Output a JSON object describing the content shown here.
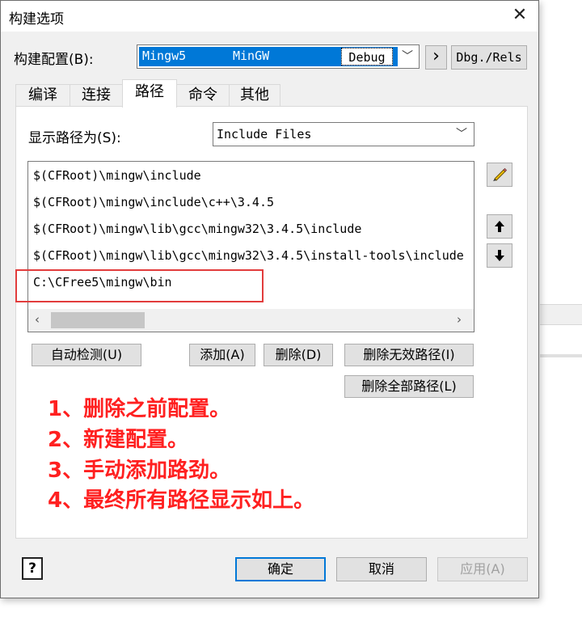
{
  "window": {
    "title": "构建选项",
    "close_glyph": "✕"
  },
  "config": {
    "label": "构建配置(B):",
    "name": "Mingw5",
    "compiler": "MinGW",
    "mode": "Debug",
    "arrow_btn": "›",
    "dbg_rels_btn": "Dbg./Rels"
  },
  "tabs": [
    {
      "label": "编译"
    },
    {
      "label": "连接"
    },
    {
      "label": "路径"
    },
    {
      "label": "命令"
    },
    {
      "label": "其他"
    }
  ],
  "path_view": {
    "label": "显示路径为(S):",
    "selected": "Include Files"
  },
  "paths": [
    "$(CFRoot)\\mingw\\include",
    "$(CFRoot)\\mingw\\include\\c++\\3.4.5",
    "$(CFRoot)\\mingw\\lib\\gcc\\mingw32\\3.4.5\\include",
    "$(CFRoot)\\mingw\\lib\\gcc\\mingw32\\3.4.5\\install-tools\\include",
    "C:\\CFree5\\mingw\\bin"
  ],
  "actions": {
    "auto_detect": "自动检测(U)",
    "add": "添加(A)",
    "delete": "删除(D)",
    "delete_invalid": "删除无效路径(I)",
    "delete_all": "删除全部路径(L)"
  },
  "notes": [
    "1、删除之前配置。",
    "2、新建配置。",
    "3、手动添加路劲。",
    "4、最终所有路径显示如上。"
  ],
  "footer": {
    "help": "?",
    "ok": "确定",
    "cancel": "取消",
    "apply": "应用(A)"
  },
  "colors": {
    "note_red": "#ff2020",
    "selection_blue": "#0078d7",
    "box_red": "#e23c3c"
  },
  "icons": {
    "edit": "pencil-icon",
    "up": "arrow-up-icon",
    "down": "arrow-down-icon",
    "dropdown": "chevron-down-icon"
  }
}
